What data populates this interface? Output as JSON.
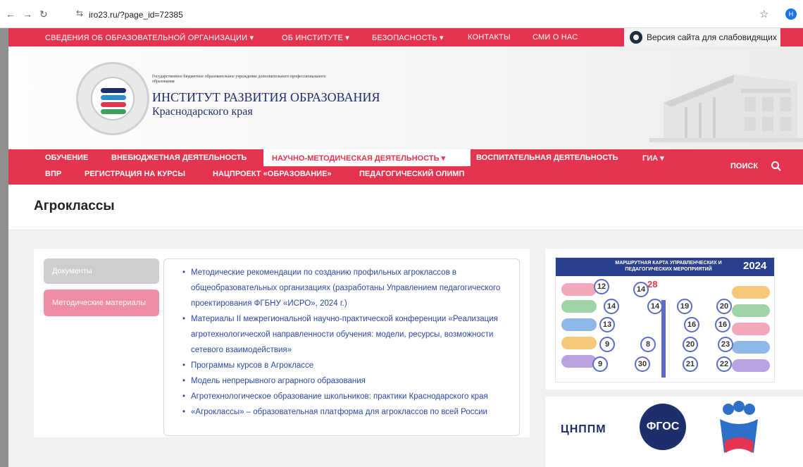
{
  "browser": {
    "url": "iro23.ru/?page_id=72385",
    "profile_initial": "Н"
  },
  "top_nav": {
    "items": [
      "СВЕДЕНИЯ ОБ ОБРАЗОВАТЕЛЬНОЙ ОРГАНИЗАЦИИ ▾",
      "ОБ ИНСТИТУТЕ ▾",
      "БЕЗОПАСНОСТЬ ▾",
      "КОНТАКТЫ",
      "СМИ О НАС"
    ],
    "accessibility_label": "Версия сайта для слабовидящих"
  },
  "header": {
    "small_text": "Государственное бюджетное образовательное учреждение дополнительного профессионального образования",
    "title": "ИНСТИТУТ РАЗВИТИЯ ОБРАЗОВАНИЯ",
    "subtitle": "Краснодарского края"
  },
  "main_nav": {
    "row1": [
      "ОБУЧЕНИЕ",
      "ВНЕБЮДЖЕТНАЯ ДЕЯТЕЛЬНОСТЬ",
      "НАУЧНО-МЕТОДИЧЕСКАЯ ДЕЯТЕЛЬНОСТЬ ▾",
      "ВОСПИТАТЕЛЬНАЯ ДЕЯТЕЛЬНОСТЬ",
      "ГИА ▾"
    ],
    "row2": [
      "ВПР",
      "РЕГИСТРАЦИЯ НА КУРСЫ",
      "НАЦПРОЕКТ «ОБРАЗОВАНИЕ»",
      "ПЕДАГОГИЧЕСКИЙ ОЛИМП"
    ],
    "search_label": "ПОИСК"
  },
  "page_title": "Агроклассы",
  "sidebar": {
    "items": [
      "Документы",
      "Методические материалы"
    ]
  },
  "materials": [
    "Методические рекомендации по созданию профильных агроклассов в общеобразовательных организациях (разработаны Управлением педагогического проектирования ФГБНУ «ИСРО», 2024 г.)",
    "Материалы II межрегиональной научно-практической конференции «Реализация агротехнологической направленности обучения: модели, ресурсы, возможности сетевого взаимодействия»",
    "Программы курсов в Агроклассе",
    "Модель непрерывного аграрного образования",
    "Агротехнологическое образование школьников: практики Краснодарского края",
    "«Агроклассы» – образовательная платформа для агроклассов по всей России"
  ],
  "poster": {
    "title": "МАРШРУТНАЯ КАРТА УПРАВЛЕНЧЕСКИХ И ПЕДАГОГИЧЕСКИХ МЕРОПРИЯТИЙ",
    "year": "2024",
    "highlight": "28",
    "numbers": [
      "12",
      "14",
      "14",
      "14",
      "19",
      "20",
      "13",
      "16",
      "16",
      "9",
      "8",
      "20",
      "23",
      "9",
      "30",
      "21",
      "22"
    ]
  },
  "partners": {
    "cnppm": "ЦНППМ",
    "fgos": "ФГОС"
  },
  "colors": {
    "brand_red": "#e5344f",
    "navy": "#1d2f6b",
    "link_blue": "#2b4aa8",
    "pink_button": "#f08ca4"
  }
}
